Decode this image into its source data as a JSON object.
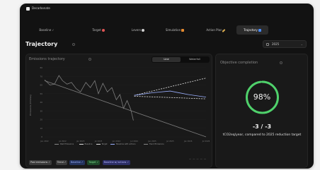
{
  "app": {
    "title": "Decarbonate"
  },
  "nav": {
    "items": [
      {
        "label": "Baseline",
        "icon": "check-icon",
        "color": "#9a9a9a",
        "active": false
      },
      {
        "label": "Target",
        "icon": "dart-icon",
        "color": "#e05555",
        "active": false
      },
      {
        "label": "Levers",
        "icon": "gear-icon",
        "color": "#c9c9c9",
        "active": false
      },
      {
        "label": "Simulation",
        "icon": "chart-icon",
        "color": "#e58a2f",
        "active": false
      },
      {
        "label": "Action Plan",
        "icon": "pencil-icon",
        "color": "#e0b050",
        "active": false
      },
      {
        "label": "Trajectory",
        "icon": "trend-icon",
        "color": "#4a8cff",
        "active": true
      }
    ]
  },
  "page": {
    "title": "Trajectory",
    "year": "2025"
  },
  "trajectory_panel": {
    "title": "Emissions trajectory",
    "toggle": {
      "line": "Line",
      "waterfall": "Waterfall",
      "active": "line"
    }
  },
  "objective_panel": {
    "title": "Objective completion",
    "percent_label": "98%",
    "percent": 0.98,
    "ratio": "-3 / -3",
    "target_text": "tCO2eq/year, compared to 2025 reduction target",
    "ring_color": "#4fd16b"
  },
  "chart_data": {
    "type": "line",
    "ylabel": "Emissions (tCO2eq)",
    "x_ticks": [
      "Jan 2022",
      "Jul 2022",
      "Jan 2023",
      "Jul 2023",
      "Jan 2024",
      "Jul 2024",
      "Jan 2025",
      "Jul 2025",
      "Jan 2026",
      "Jul 2026"
    ],
    "y_ticks": [
      0,
      10,
      20,
      30,
      40,
      50,
      60,
      70,
      80
    ],
    "ylim": [
      0,
      80
    ],
    "series": [
      {
        "name": "Past Emissions",
        "color": "#7d7d7d",
        "dash": false,
        "x": [
          0.0,
          0.3,
          0.55,
          0.8,
          1.0,
          1.25,
          1.5,
          1.75,
          2.0,
          2.3,
          2.55,
          2.8,
          3.0,
          3.25,
          3.5,
          3.75,
          4.0,
          4.2,
          4.4,
          4.6,
          4.8,
          4.95
        ],
        "y": [
          66,
          60,
          61,
          71,
          65,
          61,
          63,
          56,
          52,
          63,
          57,
          65,
          50,
          62,
          52,
          57,
          43,
          49,
          33,
          42,
          32,
          19
        ]
      },
      {
        "name": "Baseline",
        "color": "#e6e6e6",
        "dash": true,
        "x": [
          5,
          9
        ],
        "y": [
          48,
          68
        ]
      },
      {
        "name": "Target",
        "color": "#e6e6e6",
        "dash": true,
        "x": [
          5,
          9
        ],
        "y": [
          47,
          44
        ]
      },
      {
        "name": "Baseline with actions",
        "color": "#9bb0ff",
        "dash": false,
        "x": [
          5,
          6,
          7,
          8,
          9
        ],
        "y": [
          48,
          51,
          53,
          49,
          46
        ]
      },
      {
        "name": "Trend Emissions",
        "color": "#7d7d7d",
        "dash": false,
        "x": [
          0,
          9
        ],
        "y": [
          65,
          0
        ]
      }
    ]
  },
  "legend": [
    {
      "label": "Past Emissions",
      "color": "#888888",
      "dash": false
    },
    {
      "label": "Baseline",
      "color": "#dddddd",
      "dash": true
    },
    {
      "label": "Target",
      "color": "#dddddd",
      "dash": true
    },
    {
      "label": "Baseline with actions",
      "color": "#9bb0ff",
      "dash": false
    },
    {
      "label": "Trend Emissions",
      "color": "#888888",
      "dash": false
    }
  ],
  "filters": [
    {
      "label": "Past emissions",
      "check": "✓",
      "bg": "#3a3a3a",
      "fg": "#e0e0e0"
    },
    {
      "label": "Trend",
      "check": "✓",
      "bg": "#3a3a3a",
      "fg": "#e0e0e0"
    },
    {
      "label": "Baseline",
      "check": "✓",
      "bg": "#24335e",
      "fg": "#9fb4ff"
    },
    {
      "label": "Target",
      "check": "✓",
      "bg": "#1f4a2a",
      "fg": "#7fe08f"
    },
    {
      "label": "Baseline w/ actions",
      "check": "✓",
      "bg": "#2d2f66",
      "fg": "#b8b8ff"
    }
  ]
}
